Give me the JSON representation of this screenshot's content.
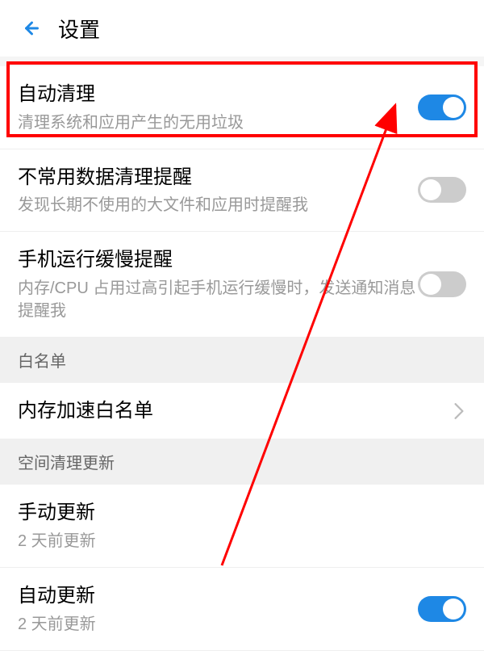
{
  "header": {
    "title": "设置"
  },
  "items": {
    "autoClean": {
      "title": "自动清理",
      "subtitle": "清理系统和应用产生的无用垃圾",
      "enabled": true
    },
    "rarelyUsedReminder": {
      "title": "不常用数据清理提醒",
      "subtitle": "发现长期不使用的大文件和应用时提醒我",
      "enabled": false
    },
    "slowPhoneReminder": {
      "title": "手机运行缓慢提醒",
      "subtitle": "内存/CPU 占用过高引起手机运行缓慢时，发送通知消息提醒我",
      "enabled": false
    },
    "whitelist": {
      "title": "白名单"
    },
    "memoryWhitelist": {
      "title": "内存加速白名单"
    },
    "spaceCleanUpdate": {
      "title": "空间清理更新"
    },
    "manualUpdate": {
      "title": "手动更新",
      "subtitle": "2 天前更新"
    },
    "autoUpdate": {
      "title": "自动更新",
      "subtitle": "2 天前更新",
      "enabled": true
    }
  }
}
